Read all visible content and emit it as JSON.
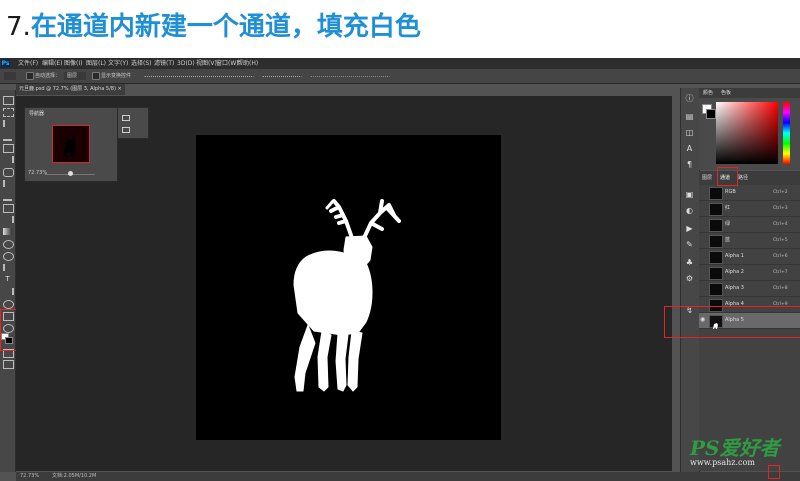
{
  "tutorial": {
    "step_number": "7.",
    "step_text": "在通道内新建一个通道，填充白色"
  },
  "app": {
    "logo": "Ps"
  },
  "menu": [
    "文件(F)",
    "编辑(E)",
    "图像(I)",
    "图层(L)",
    "文字(Y)",
    "选择(S)",
    "滤镜(T)",
    "3D(D)",
    "视图(V)",
    "窗口(W)",
    "帮助(H)"
  ],
  "options": {
    "auto_select_label": "自动选择：",
    "auto_select_value": "图层",
    "transform_label": "显示变换控件"
  },
  "document": {
    "tab_title": "元旦鹿.psd @ 72.7% (图层 3, Alpha 5/8)",
    "tab_close": "×"
  },
  "navigator": {
    "title": "导航器",
    "zoom": "72.73%"
  },
  "status": {
    "zoom": "72.73%",
    "doc_info": "文档:2.05M/10.2M"
  },
  "color_panel": {
    "tabs": [
      "颜色",
      "色板"
    ]
  },
  "channels_panel": {
    "tabs": [
      "图层",
      "通道",
      "路径"
    ],
    "rows": [
      {
        "name": "RGB",
        "shortcut": "Ctrl+2"
      },
      {
        "name": "红",
        "shortcut": "Ctrl+3"
      },
      {
        "name": "绿",
        "shortcut": "Ctrl+4"
      },
      {
        "name": "蓝",
        "shortcut": "Ctrl+5"
      },
      {
        "name": "Alpha 1",
        "shortcut": "Ctrl+6"
      },
      {
        "name": "Alpha 2",
        "shortcut": "Ctrl+7"
      },
      {
        "name": "Alpha 3",
        "shortcut": "Ctrl+8"
      },
      {
        "name": "Alpha 4",
        "shortcut": "Ctrl+9"
      },
      {
        "name": "Alpha 5",
        "shortcut": ""
      }
    ]
  },
  "watermark": {
    "logo": "PS爱好者",
    "url": "www.psahz.com"
  },
  "colors": {
    "accent_blue": "#1f8fd6",
    "highlight_red": "#e12424",
    "selected_row": "#696969"
  }
}
